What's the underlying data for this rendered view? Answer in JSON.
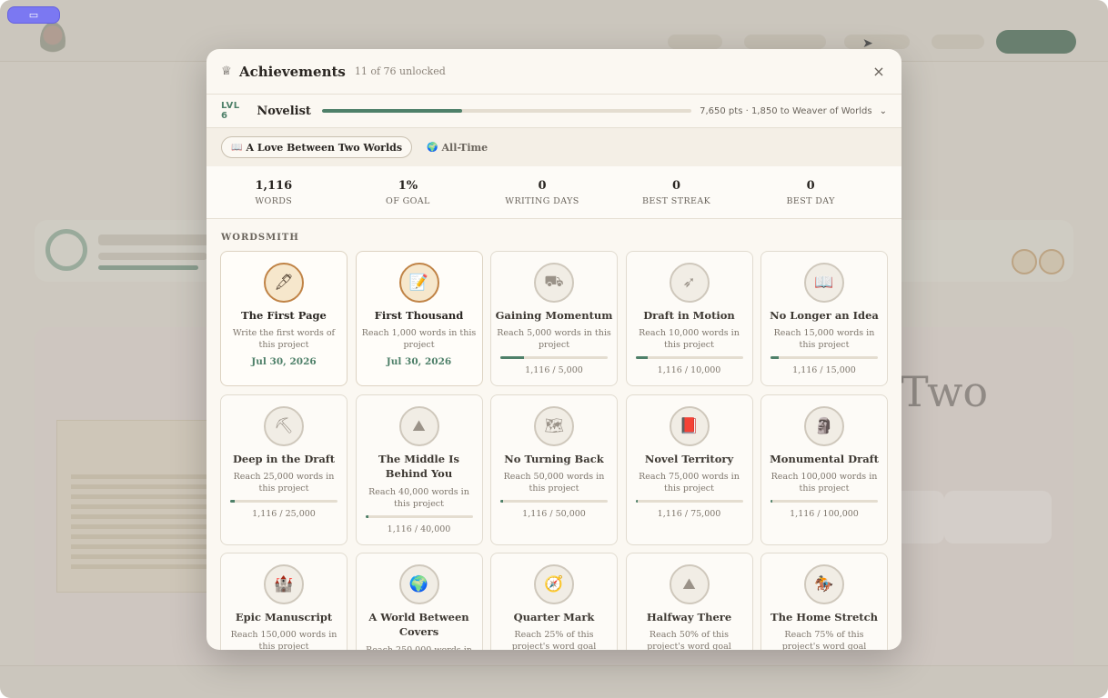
{
  "modal": {
    "title": "Achievements",
    "subtitle": "11 of 76 unlocked",
    "close_icon": "×"
  },
  "level": {
    "badge": "LVL 6",
    "name": "Novelist",
    "progress": 0.38,
    "points": "7,650 pts · 1,850 to Weaver of Worlds"
  },
  "scope": {
    "project_label": "A Love Between Two Worlds",
    "alltime_label": "All-Time"
  },
  "stats": [
    {
      "value": "1,116",
      "label": "WORDS"
    },
    {
      "value": "1%",
      "label": "OF GOAL"
    },
    {
      "value": "0",
      "label": "WRITING DAYS"
    },
    {
      "value": "0",
      "label": "BEST STREAK"
    },
    {
      "value": "0",
      "label": "BEST DAY"
    }
  ],
  "section": "WORDSMITH",
  "achievements": [
    {
      "title": "The First Page",
      "desc": "Write the first words of this project",
      "date": "Jul 30, 2026",
      "unlocked": true,
      "icon": "🖋"
    },
    {
      "title": "First Thousand",
      "desc": "Reach 1,000 words in this project",
      "date": "Jul 30, 2026",
      "unlocked": true,
      "icon": "📝"
    },
    {
      "title": "Gaining Momentum",
      "desc": "Reach 5,000 words in this project",
      "progress_text": "1,116 / 5,000",
      "progress": 0.223,
      "unlocked": false,
      "icon": "⛟"
    },
    {
      "title": "Draft in Motion",
      "desc": "Reach 10,000 words in this project",
      "progress_text": "1,116 / 10,000",
      "progress": 0.112,
      "unlocked": false,
      "icon": "➶"
    },
    {
      "title": "No Longer an Idea",
      "desc": "Reach 15,000 words in this project",
      "progress_text": "1,116 / 15,000",
      "progress": 0.074,
      "unlocked": false,
      "icon": "📖"
    },
    {
      "title": "Deep in the Draft",
      "desc": "Reach 25,000 words in this project",
      "progress_text": "1,116 / 25,000",
      "progress": 0.045,
      "unlocked": false,
      "icon": "⛏"
    },
    {
      "title": "The Middle Is Behind You",
      "desc": "Reach 40,000 words in this project",
      "progress_text": "1,116 / 40,000",
      "progress": 0.028,
      "unlocked": false,
      "icon": "⛰"
    },
    {
      "title": "No Turning Back",
      "desc": "Reach 50,000 words in this project",
      "progress_text": "1,116 / 50,000",
      "progress": 0.022,
      "unlocked": false,
      "icon": "🗺"
    },
    {
      "title": "Novel Territory",
      "desc": "Reach 75,000 words in this project",
      "progress_text": "1,116 / 75,000",
      "progress": 0.015,
      "unlocked": false,
      "icon": "📕"
    },
    {
      "title": "Monumental Draft",
      "desc": "Reach 100,000 words in this project",
      "progress_text": "1,116 / 100,000",
      "progress": 0.011,
      "unlocked": false,
      "icon": "🗿"
    },
    {
      "title": "Epic Manuscript",
      "desc": "Reach 150,000 words in this project",
      "unlocked": false,
      "icon": "🏰"
    },
    {
      "title": "A World Between Covers",
      "desc": "Reach 250,000 words in",
      "unlocked": false,
      "icon": "🌍"
    },
    {
      "title": "Quarter Mark",
      "desc": "Reach 25% of this project's word goal",
      "unlocked": false,
      "icon": "🧭"
    },
    {
      "title": "Halfway There",
      "desc": "Reach 50% of this project's word goal",
      "unlocked": false,
      "icon": "⛰"
    },
    {
      "title": "The Home Stretch",
      "desc": "Reach 75% of this project's word goal",
      "unlocked": false,
      "icon": "🏇"
    }
  ],
  "background": {
    "big_text": "Two"
  }
}
